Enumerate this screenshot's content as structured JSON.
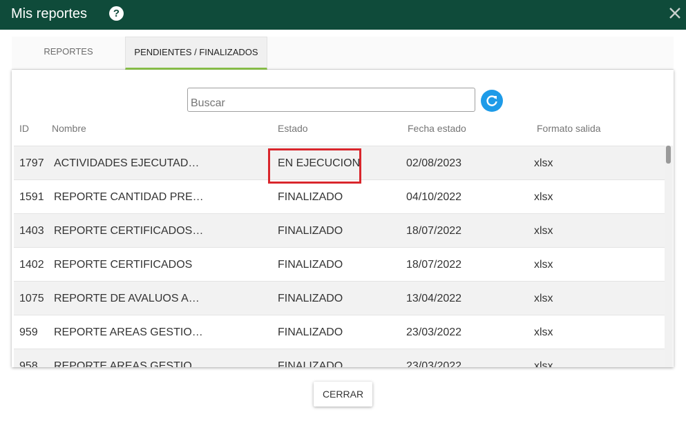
{
  "window": {
    "title": "Mis reportes",
    "help_icon": "question-circle-icon",
    "close_icon": "close-icon"
  },
  "tabs": [
    {
      "label": "REPORTES",
      "active": false
    },
    {
      "label": "PENDIENTES / FINALIZADOS",
      "active": true
    }
  ],
  "search": {
    "placeholder": "Buscar",
    "value": ""
  },
  "refresh_icon": "refresh-icon",
  "table": {
    "headers": {
      "id": "ID",
      "name": "Nombre",
      "state": "Estado",
      "date": "Fecha estado",
      "format": "Formato salida"
    },
    "rows": [
      {
        "id": "1797",
        "name": "ACTIVIDADES EJECUTAD…",
        "state": "EN EJECUCION",
        "date": "02/08/2023",
        "format": "xlsx"
      },
      {
        "id": "1591",
        "name": "REPORTE CANTIDAD PRE…",
        "state": "FINALIZADO",
        "date": "04/10/2022",
        "format": "xlsx"
      },
      {
        "id": "1403",
        "name": "REPORTE CERTIFICADOS…",
        "state": "FINALIZADO",
        "date": "18/07/2022",
        "format": "xlsx"
      },
      {
        "id": "1402",
        "name": "REPORTE CERTIFICADOS",
        "state": "FINALIZADO",
        "date": "18/07/2022",
        "format": "xlsx"
      },
      {
        "id": "1075",
        "name": "REPORTE DE AVALUOS A…",
        "state": "FINALIZADO",
        "date": "13/04/2022",
        "format": "xlsx"
      },
      {
        "id": "959",
        "name": "REPORTE AREAS GESTIO…",
        "state": "FINALIZADO",
        "date": "23/03/2022",
        "format": "xlsx"
      },
      {
        "id": "958",
        "name": "REPORTE AREAS GESTIO…",
        "state": "FINALIZADO",
        "date": "23/03/2022",
        "format": "xlsx"
      }
    ]
  },
  "footer": {
    "close_label": "CERRAR"
  },
  "colors": {
    "titlebar": "#0f4b3a",
    "tab_indicator": "#8bc34a",
    "refresh": "#1e9be8",
    "highlight": "#d9262c"
  }
}
